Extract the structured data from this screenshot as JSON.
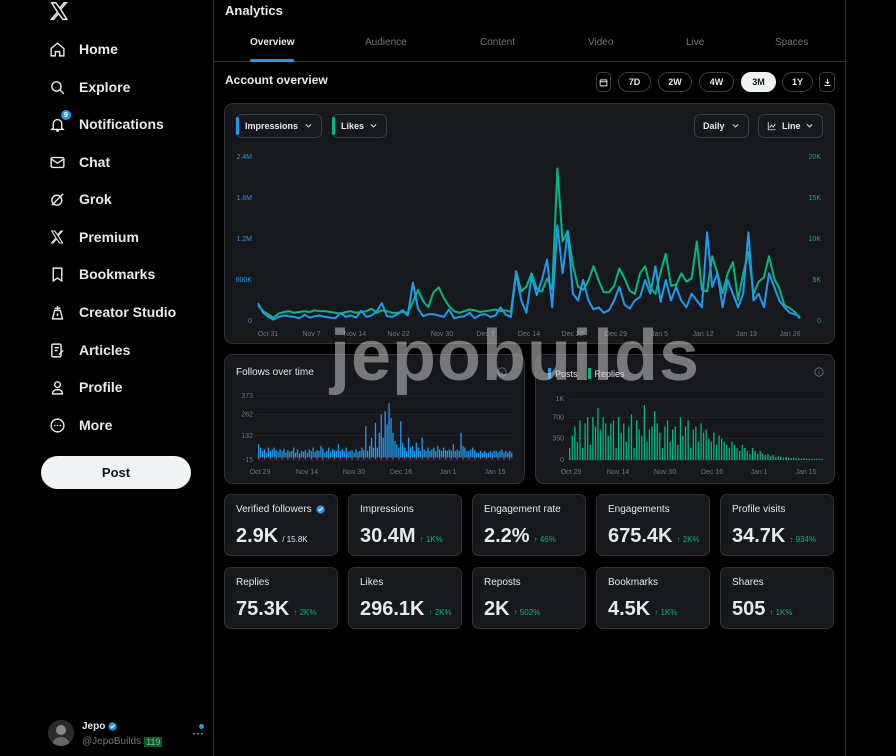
{
  "sidebar": {
    "logo": "x-logo",
    "items": [
      {
        "label": "Home",
        "icon": "home-icon"
      },
      {
        "label": "Explore",
        "icon": "search-icon"
      },
      {
        "label": "Notifications",
        "icon": "bell-icon",
        "badge": "9"
      },
      {
        "label": "Chat",
        "icon": "mail-icon"
      },
      {
        "label": "Grok",
        "icon": "grok-icon"
      },
      {
        "label": "Premium",
        "icon": "x-icon"
      },
      {
        "label": "Bookmarks",
        "icon": "bookmark-icon"
      },
      {
        "label": "Creator Studio",
        "icon": "creator-studio-icon"
      },
      {
        "label": "Articles",
        "icon": "articles-icon"
      },
      {
        "label": "Profile",
        "icon": "person-icon"
      },
      {
        "label": "More",
        "icon": "more-circle-icon"
      }
    ],
    "post_label": "Post",
    "account": {
      "name": "Jepo",
      "handle": "@JepoBuilds",
      "badge": "119"
    }
  },
  "header": {
    "title": "Analytics",
    "tabs": [
      "Overview",
      "Audience",
      "Content",
      "Video",
      "Live",
      "Spaces"
    ],
    "active_tab": "Overview"
  },
  "overview": {
    "title": "Account overview",
    "ranges": [
      "7D",
      "2W",
      "4W",
      "3M",
      "1Y"
    ],
    "active_range": "3M",
    "selectors": {
      "metric1": "Impressions",
      "metric2": "Likes",
      "interval": "Daily",
      "chart_type": "Line"
    }
  },
  "colors": {
    "impressions": "#1d9bf0",
    "likes": "#00ba7c"
  },
  "chart_data": [
    {
      "type": "line",
      "xticks": [
        "Oct 31",
        "Nov 7",
        "Nov 14",
        "Nov 22",
        "Nov 30",
        "Dec 7",
        "Dec 14",
        "Dec 22",
        "Dec 29",
        "Jan 5",
        "Jan 12",
        "Jan 19",
        "Jan 26"
      ],
      "yticks_left": [
        "0",
        "600K",
        "1.2M",
        "1.8M",
        "2.4M"
      ],
      "yticks_right": [
        "0",
        "5K",
        "10K",
        "15K",
        "20K"
      ],
      "ylim_left": [
        0,
        2400000
      ],
      "ylim_right": [
        0,
        20000
      ],
      "series": [
        {
          "name": "Impressions",
          "axis": "left",
          "values": [
            260000,
            120000,
            60000,
            20000,
            60000,
            80000,
            70000,
            60000,
            40000,
            90000,
            50000,
            70000,
            80000,
            60000,
            50000,
            40000,
            120000,
            60000,
            80000,
            50000,
            150000,
            60000,
            80000,
            140000,
            260000,
            70000,
            60000,
            100000,
            160000,
            80000,
            560000,
            180000,
            70000,
            100000,
            100000,
            80000,
            60000,
            170000,
            40000,
            60000,
            70000,
            120000,
            40000,
            90000,
            100000,
            60000,
            80000,
            200000,
            90000,
            60000,
            700000,
            300000,
            120000,
            650000,
            380000,
            600000,
            900000,
            200000,
            1400000,
            700000,
            1300000,
            400000,
            300000,
            600000,
            300000,
            170000,
            200000,
            120000,
            160000,
            300000,
            500000,
            240000,
            180000,
            300000,
            350000,
            600000,
            400000,
            800000,
            280000,
            600000,
            300000,
            500000,
            300000,
            200000,
            400000,
            300000,
            200000,
            1300000,
            500000,
            700000,
            200000,
            600000,
            400000,
            200000,
            400000,
            1300000,
            300000,
            400000,
            200000,
            700000,
            500000,
            300000,
            200000,
            120000,
            100000,
            60000
          ]
        },
        {
          "name": "Likes",
          "axis": "right",
          "values": [
            1900,
            1200,
            800,
            400,
            900,
            1100,
            1200,
            1000,
            1100,
            1200,
            1100,
            1300,
            1200,
            1200,
            1100,
            1000,
            900,
            1100,
            1200,
            1000,
            1100,
            1200,
            1500,
            1000,
            1300,
            1200,
            1000,
            1000,
            1100,
            1000,
            2300,
            3800,
            2400,
            1700,
            3500,
            4100,
            2800,
            1800,
            1200,
            1000,
            1200,
            1400,
            1300,
            1100,
            1200,
            1300,
            1400,
            1200,
            1300,
            1100,
            6100,
            3600,
            4200,
            5800,
            3900,
            3600,
            5200,
            3900,
            18600,
            9700,
            11000,
            6800,
            4200,
            3800,
            4900,
            6700,
            4900,
            3500,
            3500,
            4300,
            6400,
            5200,
            3700,
            3300,
            5800,
            6700,
            4100,
            3300,
            6000,
            8200,
            4300,
            4400,
            5800,
            4800,
            5200,
            9700,
            3800,
            3600,
            7900,
            5800,
            3400,
            5800,
            7200,
            2600,
            5800,
            8400,
            3300,
            4800,
            5300,
            7900,
            5200,
            3900,
            1900,
            1600,
            1100,
            300
          ]
        }
      ]
    },
    {
      "type": "bar",
      "title": "Follows over time",
      "xticks": [
        "Oct 29",
        "Nov 14",
        "Nov 30",
        "Dec 16",
        "Jan 1",
        "Jan 15"
      ],
      "yticks": [
        "-15",
        "132",
        "262",
        "373"
      ],
      "ylim": [
        -15,
        373
      ],
      "values": [
        80,
        60,
        40,
        50,
        30,
        60,
        40,
        50,
        60,
        45,
        35,
        50,
        40,
        55,
        30,
        45,
        35,
        40,
        60,
        30,
        50,
        25,
        40,
        35,
        45,
        30,
        50,
        40,
        60,
        35,
        45,
        40,
        70,
        55,
        30,
        40,
        60,
        35,
        50,
        45,
        40,
        80,
        40,
        50,
        40,
        60,
        35,
        40,
        45,
        30,
        50,
        35,
        40,
        60,
        45,
        190,
        40,
        70,
        120,
        60,
        210,
        60,
        150,
        260,
        120,
        280,
        200,
        330,
        240,
        150,
        100,
        80,
        60,
        220,
        90,
        60,
        40,
        120,
        60,
        70,
        40,
        90,
        60,
        40,
        120,
        50,
        40,
        60,
        40,
        50,
        60,
        40,
        70,
        50,
        40,
        60,
        45,
        40,
        50,
        40,
        80,
        40,
        50,
        40,
        150,
        70,
        60,
        40,
        40,
        50,
        60,
        45,
        30,
        30,
        40,
        30,
        40,
        30,
        30,
        40,
        30,
        40,
        40,
        30,
        40,
        50,
        30,
        40,
        30,
        40,
        30
      ]
    },
    {
      "type": "bar",
      "series": [
        {
          "name": "Posts",
          "values": []
        },
        {
          "name": "Replies",
          "values": [
            200,
            400,
            550,
            300,
            650,
            200,
            600,
            700,
            250,
            700,
            550,
            850,
            500,
            700,
            600,
            400,
            600,
            650,
            200,
            700,
            450,
            600,
            300,
            550,
            750,
            200,
            650,
            500,
            400,
            900,
            300,
            500,
            550,
            800,
            600,
            450,
            200,
            550,
            650,
            300,
            500,
            550,
            250,
            700,
            400,
            550,
            650,
            200,
            500,
            550,
            300,
            600,
            450,
            500,
            350,
            300,
            450,
            250,
            400,
            350,
            300,
            250,
            200,
            300,
            250,
            200,
            150,
            250,
            200,
            150,
            100,
            200,
            150,
            100,
            150,
            100,
            80,
            100,
            60,
            80,
            50,
            60,
            50,
            40,
            50,
            40,
            30,
            40,
            30,
            30,
            20,
            30,
            20,
            20,
            20,
            20,
            20,
            20,
            20
          ]
        }
      ],
      "xticks": [
        "Oct 29",
        "Nov 14",
        "Nov 30",
        "Dec 16",
        "Jan 1",
        "Jan 15"
      ],
      "yticks": [
        "0",
        "350",
        "700",
        "1K"
      ],
      "ylim": [
        0,
        1050
      ]
    }
  ],
  "stats": [
    {
      "label": "Verified followers",
      "value": "2.9K",
      "sub": "/ 15.8K",
      "change": "",
      "verified": true
    },
    {
      "label": "Impressions",
      "value": "30.4M",
      "change": "↑ 1K%"
    },
    {
      "label": "Engagement rate",
      "value": "2.2%",
      "change": "↑ 46%"
    },
    {
      "label": "Engagements",
      "value": "675.4K",
      "change": "↑ 2K%"
    },
    {
      "label": "Profile visits",
      "value": "34.7K",
      "change": "↑ 934%"
    },
    {
      "label": "Replies",
      "value": "75.3K",
      "change": "↑ 2K%"
    },
    {
      "label": "Likes",
      "value": "296.1K",
      "change": "↑ 2K%"
    },
    {
      "label": "Reposts",
      "value": "2K",
      "change": "↑ 502%"
    },
    {
      "label": "Bookmarks",
      "value": "4.5K",
      "change": "↑ 1K%"
    },
    {
      "label": "Shares",
      "value": "505",
      "change": "↑ 1K%"
    }
  ],
  "watermark": "jepobuilds"
}
